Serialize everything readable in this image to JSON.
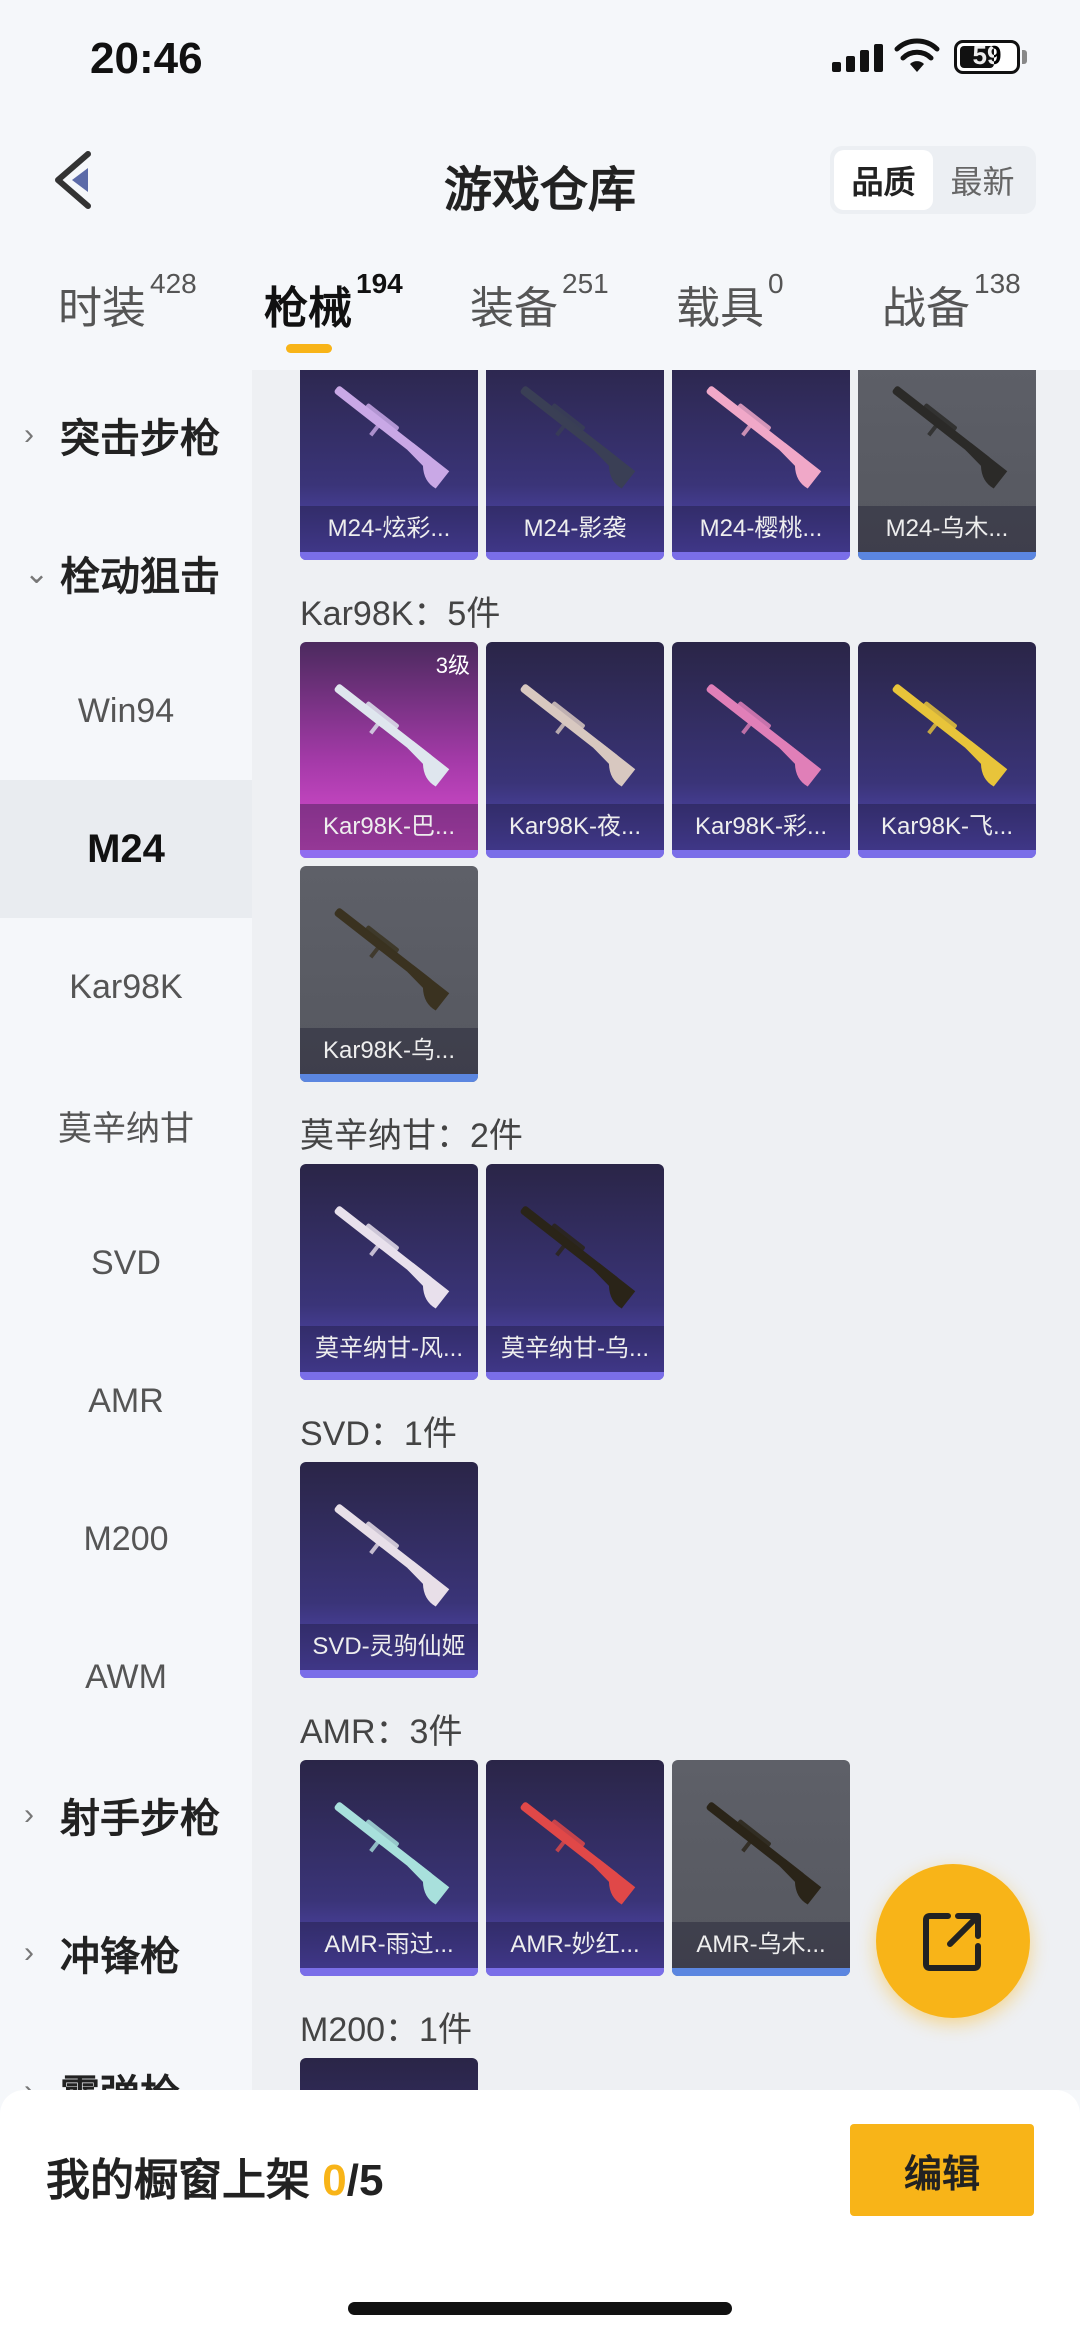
{
  "status": {
    "time": "20:46",
    "battery": "59"
  },
  "header": {
    "title": "游戏仓库",
    "sort_options": [
      "品质",
      "最新"
    ],
    "sort_selected": "品质"
  },
  "category_tabs": [
    {
      "label": "时装",
      "count": "428"
    },
    {
      "label": "枪械",
      "count": "194",
      "active": true
    },
    {
      "label": "装备",
      "count": "251"
    },
    {
      "label": "载具",
      "count": "0"
    },
    {
      "label": "战备",
      "count": "138"
    }
  ],
  "sidebar": [
    {
      "label": "突击步枪",
      "group": true,
      "expanded": false
    },
    {
      "label": "栓动狙击",
      "group": true,
      "expanded": true
    },
    {
      "label": "Win94"
    },
    {
      "label": "M24",
      "selected": true
    },
    {
      "label": "Kar98K"
    },
    {
      "label": "莫辛纳甘"
    },
    {
      "label": "SVD"
    },
    {
      "label": "AMR"
    },
    {
      "label": "M200"
    },
    {
      "label": "AWM"
    },
    {
      "label": "射手步枪",
      "group": true,
      "expanded": false
    },
    {
      "label": "冲锋枪",
      "group": true,
      "expanded": false
    },
    {
      "label": "霰弹枪",
      "group": true,
      "expanded": false
    }
  ],
  "sections": [
    {
      "heading": "",
      "items": [
        {
          "name": "M24-炫彩...",
          "rarity": "epic",
          "gun": "#c9a8e6"
        },
        {
          "name": "M24-影袭",
          "rarity": "epic",
          "gun": "#3a3f55"
        },
        {
          "name": "M24-樱桃...",
          "rarity": "epic",
          "gun": "#f0a8c8"
        },
        {
          "name": "M24-乌木...",
          "rarity": "rare",
          "gun": "#2b2a28"
        }
      ]
    },
    {
      "heading": "Kar98K：5件",
      "items": [
        {
          "name": "Kar98K-巴...",
          "rarity": "legend",
          "level": "3级",
          "gun": "#dfe6ee"
        },
        {
          "name": "Kar98K-夜...",
          "rarity": "epic",
          "gun": "#d8c8c0"
        },
        {
          "name": "Kar98K-彩...",
          "rarity": "epic",
          "gun": "#e07fb8"
        },
        {
          "name": "Kar98K-飞...",
          "rarity": "epic",
          "gun": "#e8c43a"
        },
        {
          "name": "Kar98K-乌...",
          "rarity": "rare",
          "gun": "#3a3220"
        }
      ]
    },
    {
      "heading": "莫辛纳甘：2件",
      "items": [
        {
          "name": "莫辛纳甘-风...",
          "rarity": "epic",
          "gun": "#e8e0ec"
        },
        {
          "name": "莫辛纳甘-乌...",
          "rarity": "epic",
          "gun": "#2a2418"
        }
      ]
    },
    {
      "heading": "SVD：1件",
      "items": [
        {
          "name": "SVD-灵驹仙姬",
          "rarity": "epic",
          "gun": "#e8dfe8"
        }
      ]
    },
    {
      "heading": "AMR：3件",
      "items": [
        {
          "name": "AMR-雨过...",
          "rarity": "epic",
          "gun": "#a8e0dc"
        },
        {
          "name": "AMR-妙红...",
          "rarity": "epic",
          "gun": "#e04848"
        },
        {
          "name": "AMR-乌木...",
          "rarity": "rare",
          "gun": "#2a2418"
        }
      ]
    },
    {
      "heading": "M200：1件",
      "items": [
        {
          "name": "",
          "rarity": "epic",
          "gun": "#888"
        }
      ]
    }
  ],
  "showcase": {
    "label": "我的橱窗上架 ",
    "current": "0",
    "total": "/5",
    "edit_label": "编辑"
  },
  "colors": {
    "accent": "#f8b418",
    "epic_bar": "#7a6ee8",
    "rare_bar": "#5b86e0"
  }
}
